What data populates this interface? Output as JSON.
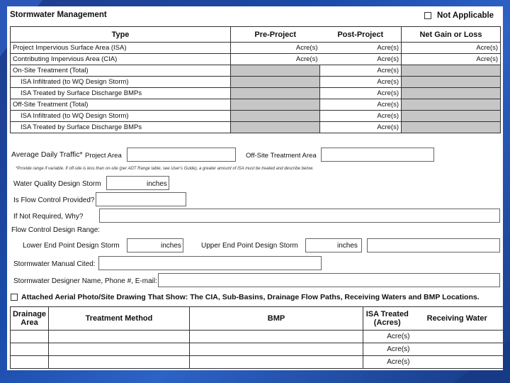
{
  "header": {
    "title": "Stormwater Management",
    "not_applicable": "Not Applicable"
  },
  "table1": {
    "headers": [
      "Type",
      "Pre-Project",
      "Post-Project",
      "Net Gain or Loss"
    ],
    "rows": [
      {
        "label": "Project Impervious Surface Area (ISA)",
        "pre": "Acre(s)",
        "post": "Acre(s)",
        "net": "Acre(s)"
      },
      {
        "label": "Contributing Impervious Area (CIA)",
        "pre": "Acre(s)",
        "post": "Acre(s)",
        "net": "Acre(s)"
      },
      {
        "label": "On-Site Treatment (Total)",
        "pre": "",
        "post": "Acre(s)",
        "net": ""
      },
      {
        "label": "ISA Infiltrated (to WQ Design Storm)",
        "pre": "",
        "post": "Acre(s)",
        "net": ""
      },
      {
        "label": "ISA Treated by Surface Discharge BMPs",
        "pre": "",
        "post": "Acre(s)",
        "net": ""
      },
      {
        "label": "Off-Site Treatment (Total)",
        "pre": "",
        "post": "Acre(s)",
        "net": ""
      },
      {
        "label": "ISA Infiltrated (to WQ Design Storm)",
        "pre": "",
        "post": "Acre(s)",
        "net": ""
      },
      {
        "label": "ISA Treated by Surface Discharge BMPs",
        "pre": "",
        "post": "Acre(s)",
        "net": ""
      }
    ]
  },
  "traffic": {
    "label": "Average Daily Traffic*",
    "project_area": "Project Area",
    "offsite_area": "Off-Site Treatment Area",
    "note": "*Provide range if variable. If off-site is less than on-site (per ADT Range table, see User's Guide), a greater amount of ISA must be treated and describe below."
  },
  "wq_storm": {
    "label": "Water Quality Design Storm",
    "unit": "inches"
  },
  "flow_control": {
    "provided": "Is Flow Control Provided?",
    "why": "If Not Required, Why?",
    "range": "Flow Control Design Range:",
    "lower": "Lower End Point Design Storm",
    "upper": "Upper End Point Design Storm",
    "unit": "inches"
  },
  "manual": {
    "label": "Stormwater Manual Cited:"
  },
  "designer": {
    "label": "Stormwater Designer Name, Phone #, E-mail:"
  },
  "attached": {
    "label": "Attached Aerial Photo/Site Drawing That Show:  The CIA, Sub-Basins, Drainage Flow Paths, Receiving Waters and BMP Locations."
  },
  "table2": {
    "headers": [
      "Drainage Area",
      "Treatment Method",
      "BMP",
      "ISA Treated (Acres)",
      "Receiving Water"
    ],
    "rows": [
      {
        "isa": "Acre(s)"
      },
      {
        "isa": "Acre(s)"
      },
      {
        "isa": "Acre(s)"
      }
    ]
  }
}
